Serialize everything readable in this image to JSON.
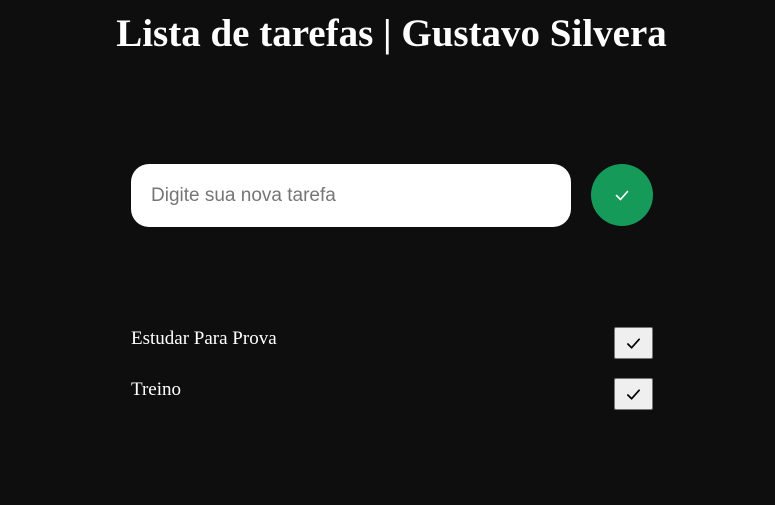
{
  "page": {
    "title": "Lista de tarefas | Gustavo Silvera"
  },
  "new_task": {
    "value": "",
    "placeholder": "Digite sua nova tarefa",
    "submit_icon": "check-icon"
  },
  "tasks": [
    {
      "label": "Estudar Para Prova",
      "done_icon": "check-icon"
    },
    {
      "label": "Treino",
      "done_icon": "check-icon"
    }
  ],
  "colors": {
    "background": "#0e0e0e",
    "accent": "#169a5a",
    "text": "#ffffff"
  }
}
